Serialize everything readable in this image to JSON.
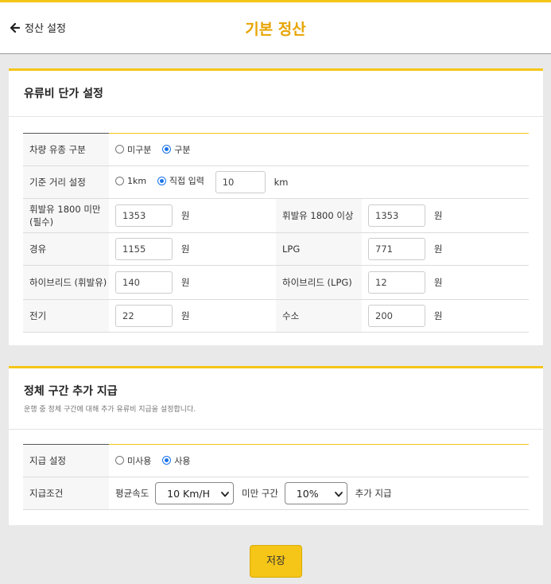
{
  "header": {
    "back_label": "정산 설정",
    "title": "기본 정산"
  },
  "fuel": {
    "title": "유류비 단가 설정",
    "rows": {
      "vehicle_type": {
        "label": "차량 유종 구분",
        "options": [
          "미구분",
          "구분"
        ],
        "selected": "구분"
      },
      "distance": {
        "label": "기준 거리 설정",
        "option_1km": "1km",
        "option_direct": "직접 입력",
        "selected": "직접 입력",
        "value": "10",
        "unit": "km"
      },
      "gasoline_lt1800": {
        "label": "휘발유 1800 미만 (필수)",
        "value": "1353",
        "unit": "원"
      },
      "gasoline_ge1800": {
        "label": "휘발유 1800 이상",
        "value": "1353",
        "unit": "원"
      },
      "diesel": {
        "label": "경유",
        "value": "1155",
        "unit": "원"
      },
      "lpg": {
        "label": "LPG",
        "value": "771",
        "unit": "원"
      },
      "hybrid_gas": {
        "label": "하이브리드 (휘발유)",
        "value": "140",
        "unit": "원"
      },
      "hybrid_lpg": {
        "label": "하이브리드 (LPG)",
        "value": "12",
        "unit": "원"
      },
      "electric": {
        "label": "전기",
        "value": "22",
        "unit": "원"
      },
      "hydrogen": {
        "label": "수소",
        "value": "200",
        "unit": "원"
      }
    }
  },
  "congestion": {
    "title": "정체 구간 추가 지급",
    "description": "운행 중 정체 구간에 대해 추가 유류비 지급을 설정합니다.",
    "payment": {
      "label": "지급 설정",
      "options": [
        "미사용",
        "사용"
      ],
      "selected": "사용"
    },
    "condition": {
      "label": "지급조건",
      "speed_label": "평균속도",
      "speed_value": "10 Km/H",
      "below_label": "미만 구간",
      "percent_value": "10%",
      "extra_label": "추가 지급"
    }
  },
  "save_label": "저장",
  "colors": {
    "accent": "#f5c518",
    "title": "#e7a400",
    "radio_selected": "#1a73e8"
  }
}
